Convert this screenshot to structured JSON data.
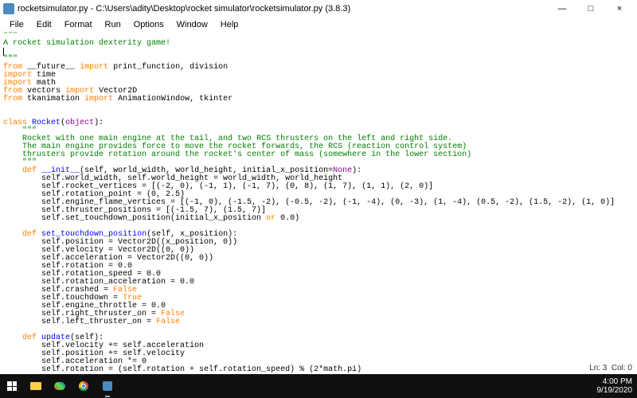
{
  "window": {
    "title": "rocketsimulator.py - C:\\Users\\adity\\Desktop\\rocket simulator\\rocketsimulator.py (3.8.3)",
    "minimize": "—",
    "maximize": "□",
    "close": "×"
  },
  "menu": [
    "File",
    "Edit",
    "Format",
    "Run",
    "Options",
    "Window",
    "Help"
  ],
  "status": {
    "ln": "Ln: 3",
    "col": "Col: 0"
  },
  "taskbar": {
    "time": "4:00 PM",
    "date": "9/19/2020"
  },
  "code": {
    "tq": "\"\"\"",
    "docline": "A rocket simulation dexterity game!",
    "import_kw": "import",
    "from_kw": "from",
    "class_kw": "class",
    "def_kw": "def",
    "future": "__future__",
    "printdiv": "print_function, division",
    "time": "time",
    "math": "math",
    "vectors": "vectors",
    "vec2d": "Vector2D",
    "tkanim": "tkanimation",
    "animwin": "AnimationWindow, tkinter",
    "rocket": "Rocket",
    "object": "object",
    "classdoc1": "Rocket with one main engine at the tail, and two RCS thrusters on the left and right side.",
    "classdoc2": "The main engine provides force to move the rocket forwards, the RCS (reaction control system)",
    "classdoc3": "thrusters provide rotation around the rocket's center of mass (somewhere in the lower section)",
    "init": "__init__",
    "self": "self",
    "args_init": ", world_width, world_height, initial_x_position=",
    "none": "None",
    "b1": "self.world_width, self.world_height = world_width, world_height",
    "b2": "self.rocket_vertices = [(-2, 0), (-1, 1), (-1, 7), (0, 8), (1, 7), (1, 1), (2, 0)]",
    "b3": "self.rotation_point = (0, 2.5)",
    "b4": "self.engine_flame_vertices = [(-1, 0), (-1.5, -2), (-0.5, -2), (-1, -4), (0, -3), (1, -4), (0.5, -2), (1.5, -2), (1, 0)]",
    "b5": "self.thruster_positions = [(-1.5, 7), (1.5, 7)]",
    "b6a": "self.set_touchdown_position(initial_x_position ",
    "or": "or",
    "b6b": " 0.0)",
    "std": "set_touchdown_position",
    "std_args": "(self, x_position):",
    "s1": "self.position = Vector2D((x_position, 0))",
    "s2": "self.velocity = Vector2D((0, 0))",
    "s3": "self.acceleration = Vector2D((0, 0))",
    "s4": "self.rotation = 0.0",
    "s5": "self.rotation_speed = 0.0",
    "s6": "self.rotation_acceleration = 0.0",
    "s7a": "self.crashed = ",
    "false": "False",
    "s8a": "self.touchdown = ",
    "true": "True",
    "s9": "self.engine_throttle = 0.0",
    "s10a": "self.right_thruster_on = ",
    "s11a": "self.left_thruster_on = ",
    "update": "update",
    "upd_args": "(self):",
    "u1": "self.velocity += self.acceleration",
    "u2": "self.position += self.velocity",
    "u3": "self.acceleration *= 0",
    "u4": "self.rotation = (self.rotation + self.rotation_speed) % (2*math.pi)"
  }
}
